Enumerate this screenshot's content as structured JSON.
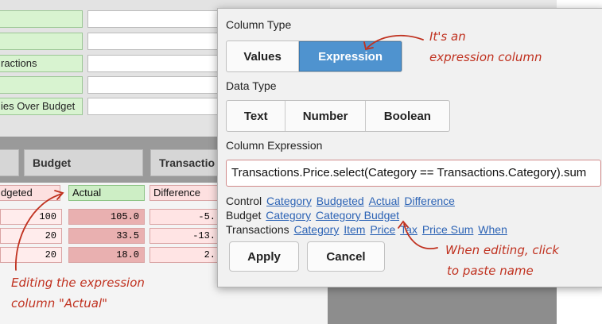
{
  "background": {
    "name_rows": [
      "",
      "",
      "ractions",
      "",
      "ies Over Budget"
    ],
    "columns": [
      "",
      "Budget",
      "Transactio"
    ],
    "fields": [
      "dgeted",
      "Actual",
      "Difference"
    ],
    "rows": [
      [
        "100",
        "105.0",
        "-5."
      ],
      [
        "20",
        "33.5",
        "-13."
      ],
      [
        "20",
        "18.0",
        "2."
      ]
    ]
  },
  "popup": {
    "column_type_label": "Column Type",
    "column_type_options": [
      "Values",
      "Expression"
    ],
    "column_type_selected": "Expression",
    "data_type_label": "Data Type",
    "data_type_options": [
      "Text",
      "Number",
      "Boolean"
    ],
    "column_expression_label": "Column Expression",
    "expression": "Transactions.Price.select(Category == Transactions.Category).sum",
    "references": [
      {
        "table": "Control",
        "columns": [
          "Category",
          "Budgeted",
          "Actual",
          "Difference"
        ]
      },
      {
        "table": "Budget",
        "columns": [
          "Category",
          "Category Budget"
        ]
      },
      {
        "table": "Transactions",
        "columns": [
          "Category",
          "Item",
          "Price",
          "Tax",
          "Price Sum",
          "When"
        ]
      }
    ],
    "apply_label": "Apply",
    "cancel_label": "Cancel"
  },
  "annotations": {
    "expression_note": [
      "It's an",
      "expression column"
    ],
    "editing_note": [
      "When editing, click",
      "to paste name"
    ],
    "actual_note": [
      "Editing the expression",
      "column \"Actual\""
    ],
    "color": "#c0311f"
  }
}
